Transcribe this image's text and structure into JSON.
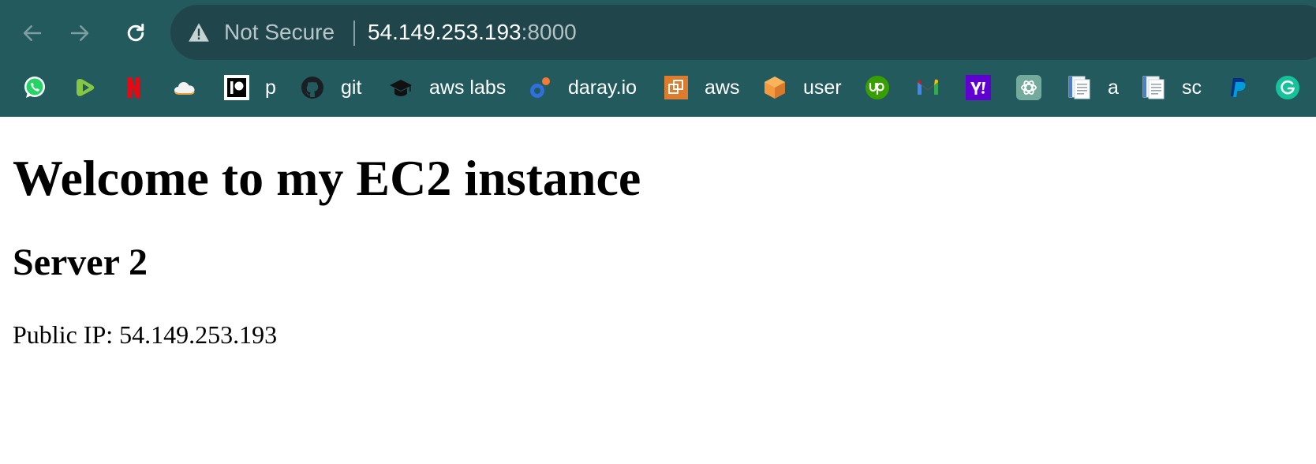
{
  "browser": {
    "nav": {
      "back_icon": "arrow-left-icon",
      "forward_icon": "arrow-right-icon",
      "reload_icon": "reload-icon"
    },
    "omnibox": {
      "security_icon": "warning-triangle-icon",
      "security_label": "Not Secure",
      "url_host": "54.149.253.193",
      "url_port": ":8000"
    },
    "bookmarks": [
      {
        "icon": "whatsapp-icon",
        "label": ""
      },
      {
        "icon": "rumble-icon",
        "label": ""
      },
      {
        "icon": "netflix-icon",
        "label": ""
      },
      {
        "icon": "cloud-icon",
        "label": ""
      },
      {
        "icon": "patreon-icon",
        "label": "p"
      },
      {
        "icon": "github-icon",
        "label": "git"
      },
      {
        "icon": "graduation-cap-icon",
        "label": "aws labs"
      },
      {
        "icon": "daray-icon",
        "label": "daray.io"
      },
      {
        "icon": "aws-console-icon",
        "label": "aws"
      },
      {
        "icon": "box-icon",
        "label": "user"
      },
      {
        "icon": "upwork-icon",
        "label": ""
      },
      {
        "icon": "gmail-icon",
        "label": ""
      },
      {
        "icon": "yahoo-icon",
        "label": ""
      },
      {
        "icon": "chatgpt-icon",
        "label": ""
      },
      {
        "icon": "document-icon",
        "label": "a"
      },
      {
        "icon": "document-icon",
        "label": "sc"
      },
      {
        "icon": "paypal-icon",
        "label": ""
      },
      {
        "icon": "grammarly-icon",
        "label": ""
      }
    ]
  },
  "page": {
    "title": "Welcome to my EC2 instance",
    "subtitle": "Server 2",
    "ip_line": "Public IP: 54.149.253.193"
  },
  "colors": {
    "chrome_bg": "#225a5e",
    "omnibox_bg": "#20464b",
    "page_bg": "#ffffff"
  }
}
